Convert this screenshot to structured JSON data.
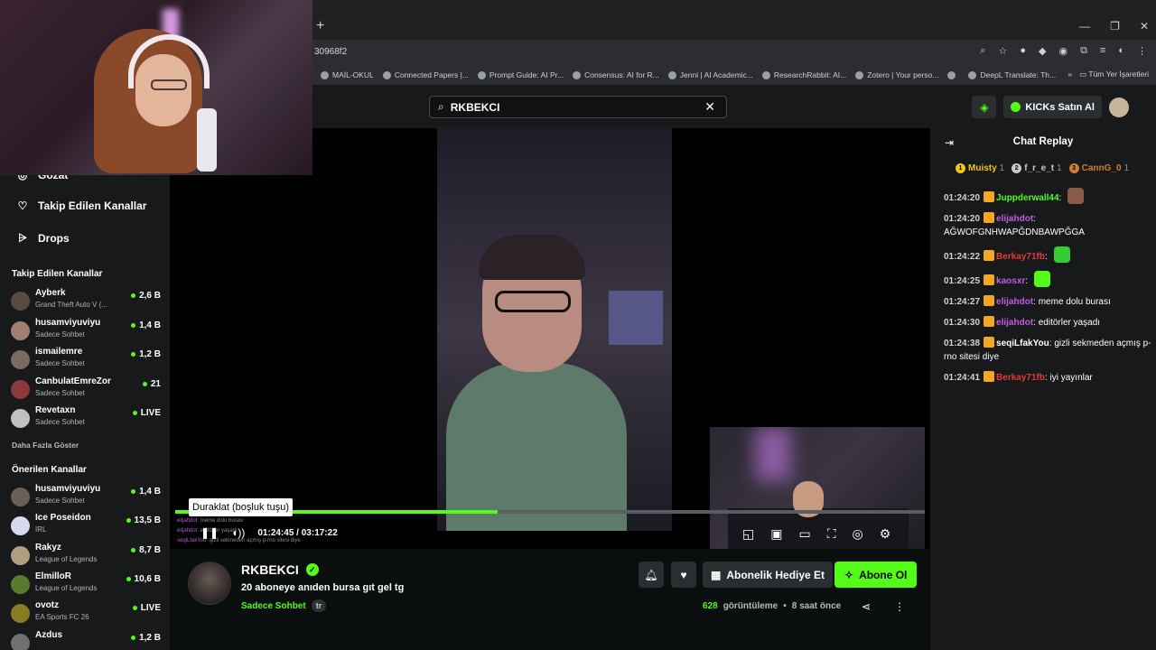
{
  "browser": {
    "url": "30968f2",
    "new_tab": "+",
    "bookmarks": [
      {
        "label": "MAİL-OKUL"
      },
      {
        "label": "Connected Papers |..."
      },
      {
        "label": "Prompt Guide: AI Pr..."
      },
      {
        "label": "Consensus: AI for R..."
      },
      {
        "label": "Jenni | AI Academic..."
      },
      {
        "label": "ResearchRabbit: AI..."
      },
      {
        "label": "Zotero | Your perso..."
      },
      {
        "label": ""
      },
      {
        "label": "DeepL Translate: Th..."
      }
    ],
    "more_bookmarks": "»",
    "all_bookmarks": "Tüm Yer İşaretleri"
  },
  "header": {
    "search_value": "RKBEKCI",
    "kicks_label": "KICKs Satın Al"
  },
  "sidebar": {
    "nav": [
      {
        "label": "Gözat",
        "icon": "compass-icon"
      },
      {
        "label": "Takip Edilen Kanallar",
        "icon": "heart-icon"
      },
      {
        "label": "Drops",
        "icon": "drops-icon"
      }
    ],
    "followed_title": "Takip Edilen Kanallar",
    "followed": [
      {
        "name": "Ayberk",
        "category": "Grand Theft Auto V (...",
        "count": "2,6 B"
      },
      {
        "name": "husamviyuviyu",
        "category": "Sadece Sohbet",
        "count": "1,4 B"
      },
      {
        "name": "ismailemre",
        "category": "Sadece Sohbet",
        "count": "1,2 B"
      },
      {
        "name": "CanbulatEmreZor",
        "category": "Sadece Sohbet",
        "count": "21"
      },
      {
        "name": "Revetaxn",
        "category": "Sadece Sohbet",
        "count": "LIVE"
      }
    ],
    "show_more": "Daha Fazla Göster",
    "recommended_title": "Önerilen Kanallar",
    "recommended": [
      {
        "name": "husamviyuviyu",
        "category": "Sadece Sohbet",
        "count": "1,4 B"
      },
      {
        "name": "Ice Poseidon",
        "category": "IRL",
        "count": "13,5 B"
      },
      {
        "name": "Rakyz",
        "category": "League of Legends",
        "count": "8,7 B"
      },
      {
        "name": "ElmilloR",
        "category": "League of Legends",
        "count": "10,6 B"
      },
      {
        "name": "ovotz",
        "category": "EA Sports FC 26",
        "count": "LIVE"
      },
      {
        "name": "Azdus",
        "category": "",
        "count": "1,2 B"
      }
    ]
  },
  "player": {
    "tooltip": "Duraklat (boşluk tuşu)",
    "current_time": "01:24:45",
    "separator": "/",
    "duration": "03:17:22",
    "progress": 0.43,
    "ghost_chat": [
      {
        "user": "elijahdot",
        "text": ": meme dolu burası"
      },
      {
        "user": "elijahdot",
        "text": ": editörler yaşadı"
      },
      {
        "user": "seqiLfakYou",
        "text": ": gizli sekmeden açmış p-rno sitesi diye"
      }
    ]
  },
  "channel": {
    "name": "RKBEKCI",
    "title": "20 aboneye anıden bursa gıt gel tg",
    "category": "Sadece Sohbet",
    "language": "tr",
    "gift_label": "Abonelik Hediye Et",
    "subscribe_label": "Abone Ol",
    "views_count": "628",
    "views_label": "görüntüleme",
    "bullet": "•",
    "time_ago": "8 saat önce"
  },
  "chat": {
    "title": "Chat Replay",
    "leaders": [
      {
        "rank": "1",
        "name": "Muisty",
        "count": "1",
        "color": "#f5c518"
      },
      {
        "rank": "2",
        "name": "f_r_e_t",
        "count": "1",
        "color": "#c8c8c8"
      },
      {
        "rank": "3",
        "name": "CannG_0",
        "count": "1",
        "color": "#cd7f32"
      }
    ],
    "messages": [
      {
        "time": "01:24:20",
        "user": "Juppderwall44",
        "color": "#53fc18",
        "text": "",
        "emote": "#8a5a4a"
      },
      {
        "time": "01:24:20",
        "user": "elijahdot",
        "color": "#c05ce6",
        "text": "AĞWOFGNHWAPĞDNBAWPĞGA",
        "emote": ""
      },
      {
        "time": "01:24:22",
        "user": "Berkay71fb",
        "color": "#e33b3b",
        "text": "",
        "emote": "#33cc33"
      },
      {
        "time": "01:24:25",
        "user": "kaosxr",
        "color": "#c05ce6",
        "text": "",
        "emote": "#53fc18"
      },
      {
        "time": "01:24:27",
        "user": "elijahdot",
        "color": "#c05ce6",
        "text": "meme dolu burası",
        "emote": ""
      },
      {
        "time": "01:24:30",
        "user": "elijahdot",
        "color": "#c05ce6",
        "text": "editörler yaşadı",
        "emote": ""
      },
      {
        "time": "01:24:38",
        "user": "seqiLfakYou",
        "color": "#ffffff",
        "text": "gizli sekmeden açmış p-rno sitesi diye",
        "emote": ""
      },
      {
        "time": "01:24:41",
        "user": "Berkay71fb",
        "color": "#e33b3b",
        "text": "iyi yayınlar",
        "emote": ""
      }
    ]
  }
}
